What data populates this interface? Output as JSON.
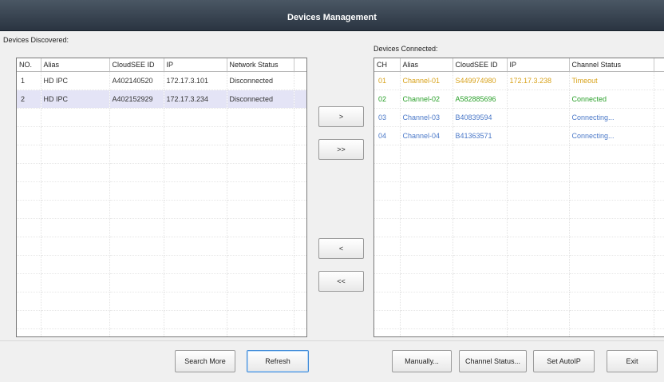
{
  "window": {
    "title": "Devices Management"
  },
  "discovered": {
    "label": "Devices Discovered:",
    "columns": [
      "NO.",
      "Alias",
      "CloudSEE ID",
      "IP",
      "Network Status"
    ],
    "rows": [
      {
        "no": "1",
        "alias": "HD IPC",
        "id": "A402140520",
        "ip": "172.17.3.101",
        "status": "Disconnected"
      },
      {
        "no": "2",
        "alias": "HD IPC",
        "id": "A402152929",
        "ip": "172.17.3.234",
        "status": "Disconnected"
      }
    ]
  },
  "connected": {
    "label": "Devices Connected:",
    "columns": [
      "CH",
      "Alias",
      "CloudSEE ID",
      "IP",
      "Channel Status"
    ],
    "rows": [
      {
        "ch": "01",
        "alias": "Channel-01",
        "id": "S449974980",
        "ip": "172.17.3.238",
        "status": "Timeout"
      },
      {
        "ch": "02",
        "alias": "Channel-02",
        "id": "A582885696",
        "ip": "",
        "status": "Connected"
      },
      {
        "ch": "03",
        "alias": "Channel-03",
        "id": "B40839594",
        "ip": "",
        "status": "Connecting..."
      },
      {
        "ch": "04",
        "alias": "Channel-04",
        "id": "B41363571",
        "ip": "",
        "status": "Connecting..."
      }
    ]
  },
  "transfer": {
    "add": ">",
    "add_all": ">>",
    "remove": "<",
    "remove_all": "<<"
  },
  "buttons": {
    "search_more": "Search More",
    "refresh": "Refresh",
    "manually": "Manually...",
    "channel_status": "Channel Status...",
    "set_auto_ip": "Set AutoIP",
    "exit": "Exit"
  },
  "colors": {
    "timeout": "#d8a21a",
    "connected": "#2aa02a",
    "connecting": "#4a78c8",
    "selected_row": "#e4e4f6"
  }
}
